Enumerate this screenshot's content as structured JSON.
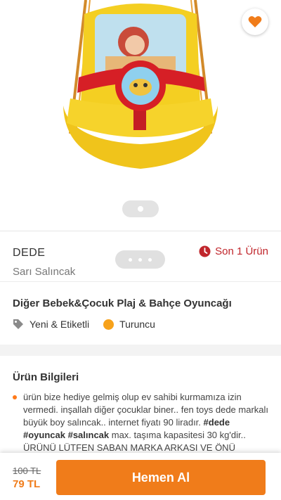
{
  "product": {
    "brand": "DEDE",
    "subtitle": "Sarı Salıncak",
    "stock_label": "Son 1 Ürün",
    "category": "Diğer Bebek&Çocuk Plaj & Bahçe Oyuncağı",
    "condition": "Yeni & Etiketli",
    "color_name": "Turuncu",
    "color_hex": "#f7a21b",
    "image_icon": "baby-swing-image"
  },
  "info": {
    "title": "Ürün Bilgileri",
    "text_part1": "ürün bize hediye gelmiş olup ev sahibi kurmamıza izin vermedi. inşallah diğer çocuklar biner.. fen toys dede markalı büyük boy salıncak.. internet fiyatı 90 liradır. ",
    "hashtags": "#dede #oyuncak #salıncak",
    "text_part2": " max. taşıma kapasitesi 30 kg'dir.. ÜRÜNÜ LÜTFEN SABAN MARKA ARKASI VE ÖNÜ SÖKÜLEBİLİR SALINCAKLARLA KARIŞTIRMAYIN VE"
  },
  "pricing": {
    "old_price": "100 TL",
    "price": "79 TL",
    "buy_label": "Hemen Al"
  },
  "colors": {
    "accent": "#f07c1a",
    "stock_red": "#c0262c"
  }
}
